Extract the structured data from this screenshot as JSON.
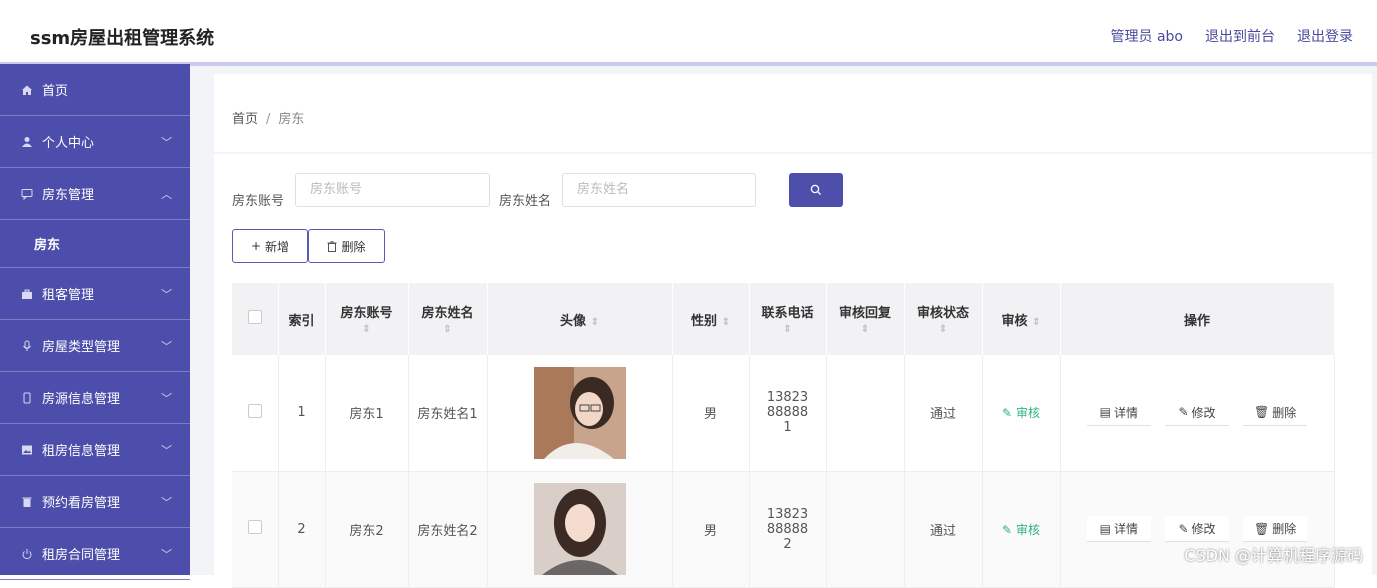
{
  "app": {
    "title": "ssm房屋出租管理系统"
  },
  "header": {
    "user_label": "管理员 abo",
    "front_link": "退出到前台",
    "logout_link": "退出登录"
  },
  "sidebar": {
    "items": [
      {
        "label": "首页",
        "icon": "home-icon"
      },
      {
        "label": "个人中心",
        "icon": "user-icon"
      },
      {
        "label": "房东管理",
        "icon": "message-icon",
        "expanded": true,
        "children": [
          {
            "label": "房东"
          }
        ]
      },
      {
        "label": "租客管理",
        "icon": "briefcase-icon"
      },
      {
        "label": "房屋类型管理",
        "icon": "mic-icon"
      },
      {
        "label": "房源信息管理",
        "icon": "phone-icon"
      },
      {
        "label": "租房信息管理",
        "icon": "image-icon"
      },
      {
        "label": "预约看房管理",
        "icon": "trash-icon"
      },
      {
        "label": "租房合同管理",
        "icon": "power-icon"
      }
    ]
  },
  "breadcrumb": {
    "home": "首页",
    "separator": "/",
    "current": "房东"
  },
  "search": {
    "account_label": "房东账号",
    "account_placeholder": "房东账号",
    "name_label": "房东姓名",
    "name_placeholder": "房东姓名"
  },
  "toolbar": {
    "add_label": "新增",
    "delete_label": "删除"
  },
  "table": {
    "headers": {
      "index": "索引",
      "account": "房东账号",
      "name": "房东姓名",
      "avatar": "头像",
      "gender": "性别",
      "phone": "联系电话",
      "reply": "审核回复",
      "status": "审核状态",
      "audit": "审核",
      "actions": "操作"
    },
    "rows": [
      {
        "index": "1",
        "account": "房东1",
        "name": "房东姓名1",
        "gender": "男",
        "phone": "13823888881",
        "reply": "",
        "status": "通过",
        "audit": "审核",
        "detail": "详情",
        "edit": "修改",
        "delete": "删除"
      },
      {
        "index": "2",
        "account": "房东2",
        "name": "房东姓名2",
        "gender": "男",
        "phone": "13823888882",
        "reply": "",
        "status": "通过",
        "audit": "审核",
        "detail": "详情",
        "edit": "修改",
        "delete": "删除"
      }
    ]
  },
  "watermark": "CSDN @计算机程序源码",
  "colors": {
    "sidebar": "#4d4dab",
    "accent": "#4e4faa",
    "audit": "#2fb37e"
  }
}
